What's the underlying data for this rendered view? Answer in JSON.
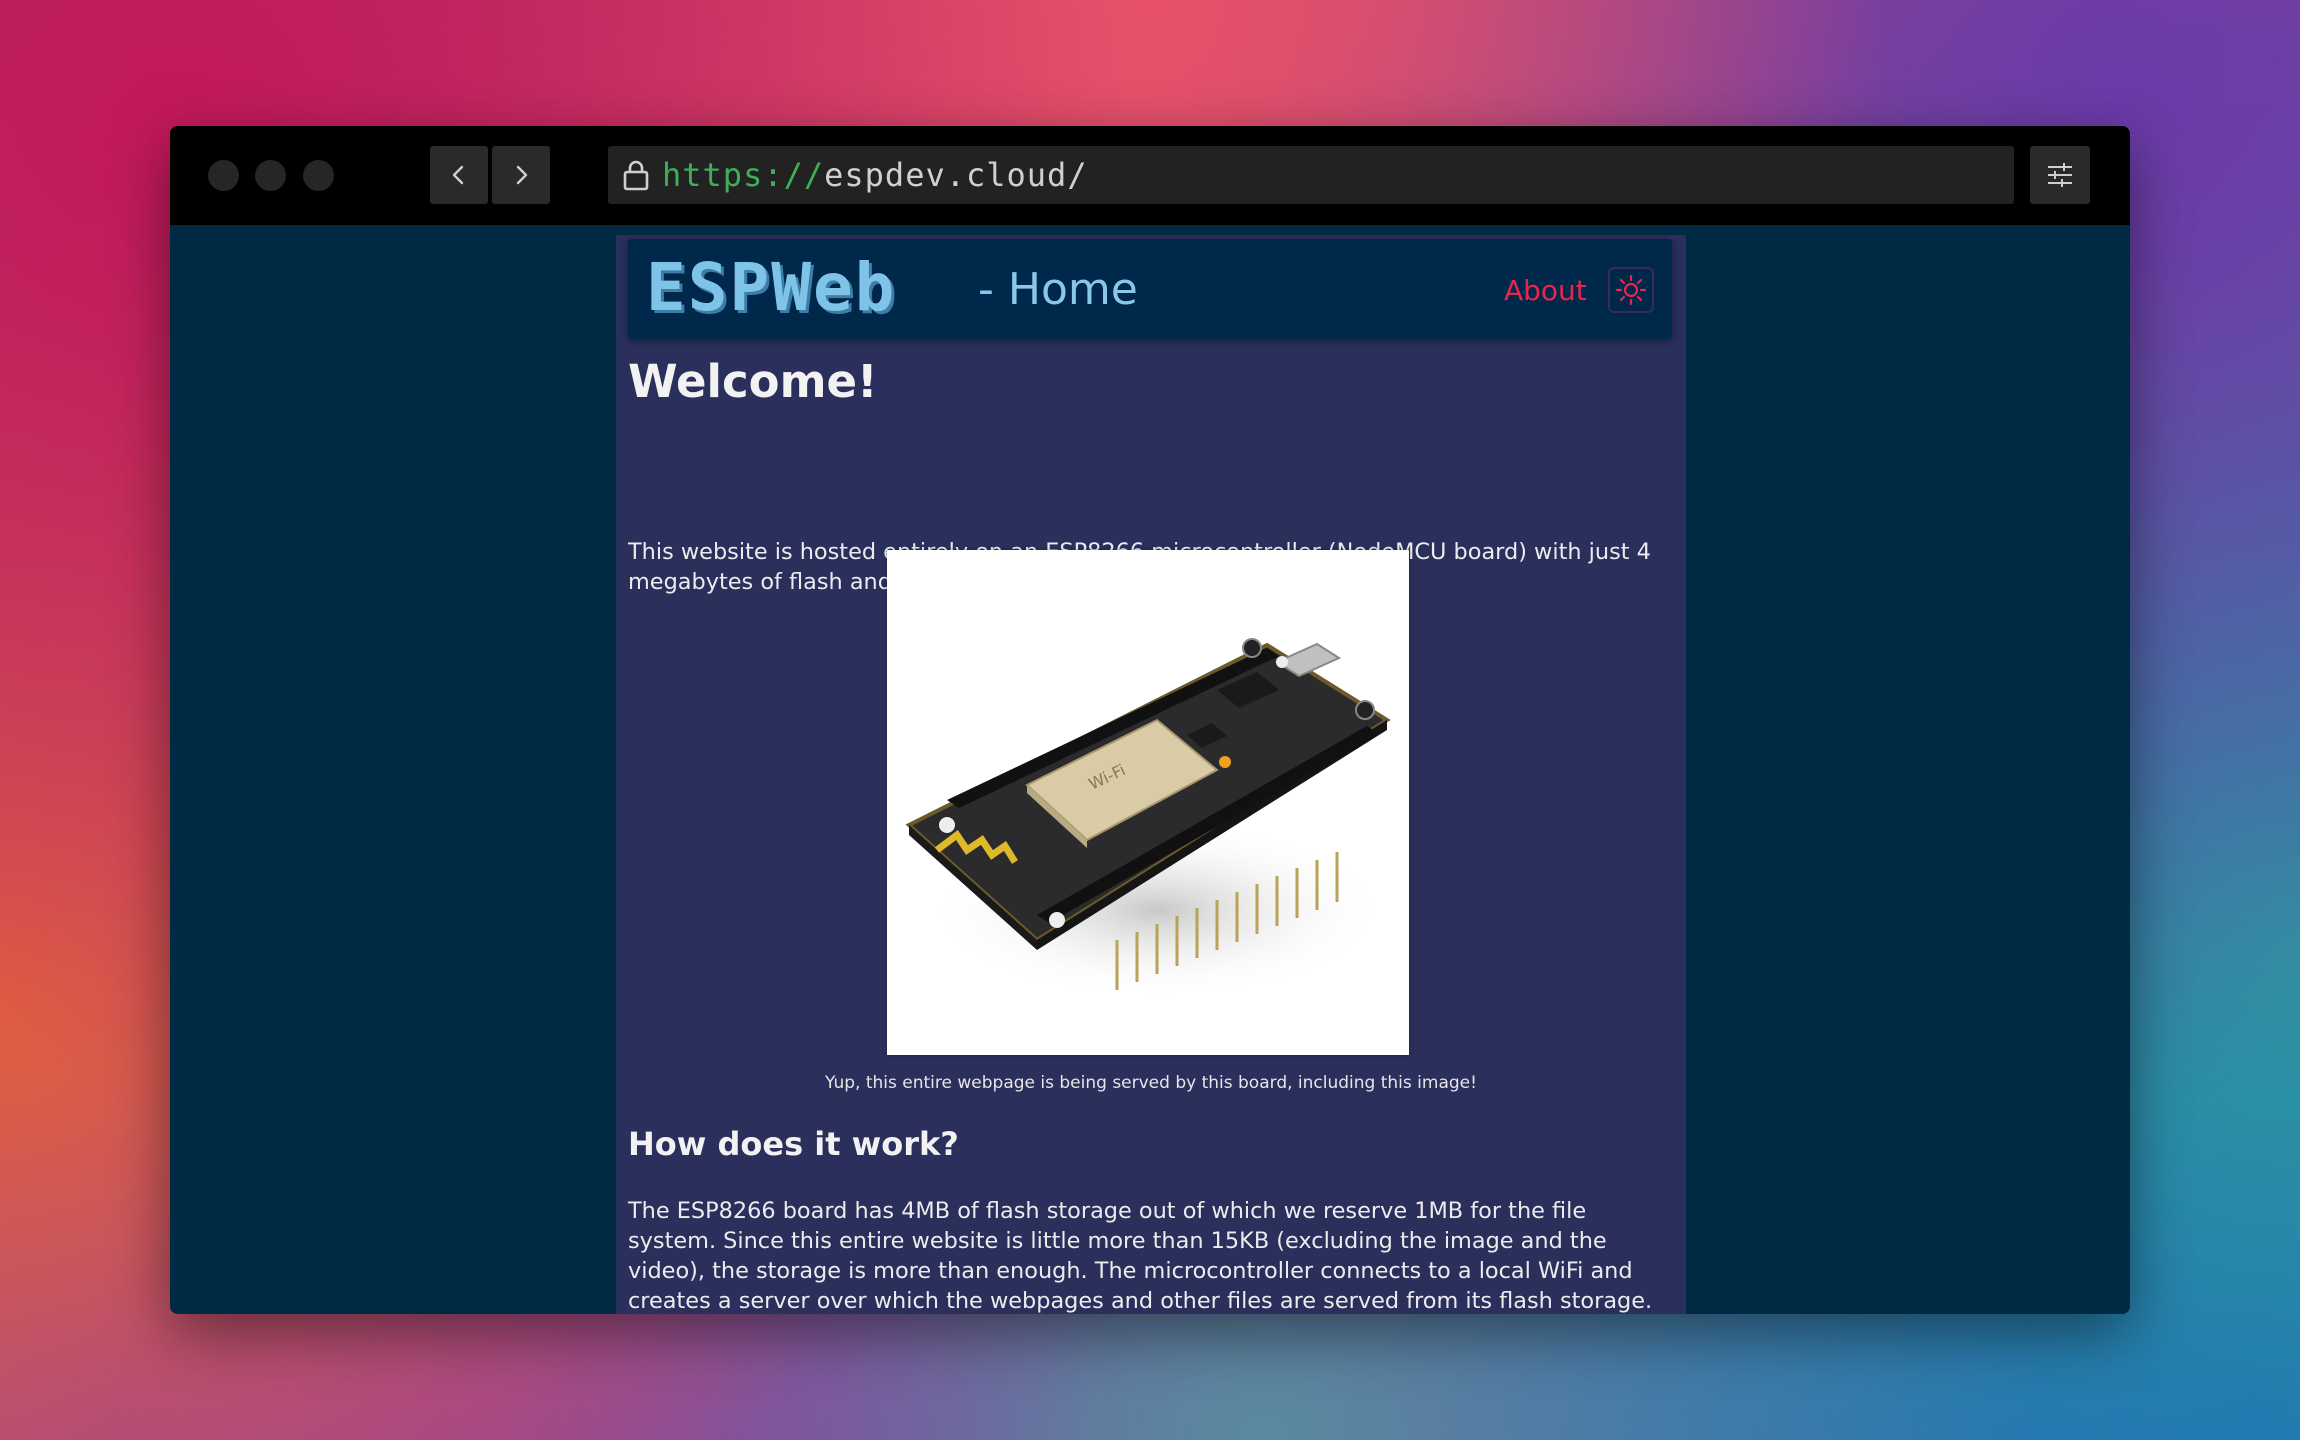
{
  "browser": {
    "url_scheme": "https://",
    "url_host": "espdev.cloud/"
  },
  "site": {
    "logo": "ESPWeb",
    "page_title": "- Home",
    "nav_about": "About"
  },
  "content": {
    "welcome_heading": "Welcome!",
    "intro_paragraph": "This website is hosted entirely on an ESP8266 microcontroller (NodeMCU board) with just 4 megabytes of flash and 128KB of SRAM!",
    "image_caption": "Yup, this entire webpage is being served by this board, including this image!",
    "how_heading": "How does it work?",
    "how_paragraph": "The ESP8266 board has 4MB of flash storage out of which we reserve 1MB for the file system. Since this entire website is little more than 15KB (excluding the image and the video), the storage is more than enough. The microcontroller connects to a local WiFi and creates a server over which the webpages and other files are served from its flash storage. There's a lot more to the process but"
  },
  "colors": {
    "accent": "#e8254a",
    "logo": "#7fc4e8",
    "page_bg": "#002a44",
    "column_bg": "#2a2f5c"
  },
  "icons": {
    "lock": "lock-icon",
    "back": "chevron-left-icon",
    "forward": "chevron-right-icon",
    "settings": "sliders-icon",
    "theme": "sun-icon"
  }
}
